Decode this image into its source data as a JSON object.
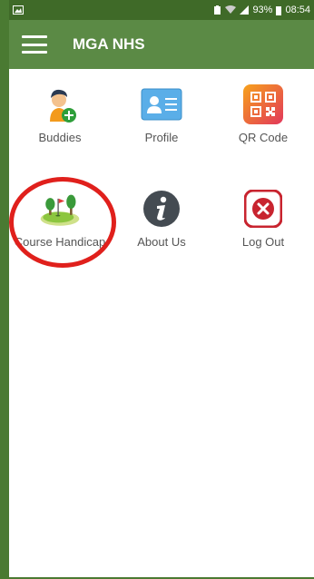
{
  "status_bar": {
    "battery": "93%",
    "time": "08:54"
  },
  "app_bar": {
    "title": "MGA NHS"
  },
  "menu": [
    {
      "label": "Buddies",
      "icon": "buddies-icon"
    },
    {
      "label": "Profile",
      "icon": "profile-card-icon"
    },
    {
      "label": "QR Code",
      "icon": "qr-code-icon"
    },
    {
      "label": "Course Handicap",
      "icon": "golf-course-icon"
    },
    {
      "label": "About Us",
      "icon": "info-icon"
    },
    {
      "label": "Log Out",
      "icon": "logout-x-icon"
    }
  ],
  "colors": {
    "app_bar": "#5b8a45",
    "status_bar": "#3f6a28",
    "annotation": "#e0201c"
  }
}
